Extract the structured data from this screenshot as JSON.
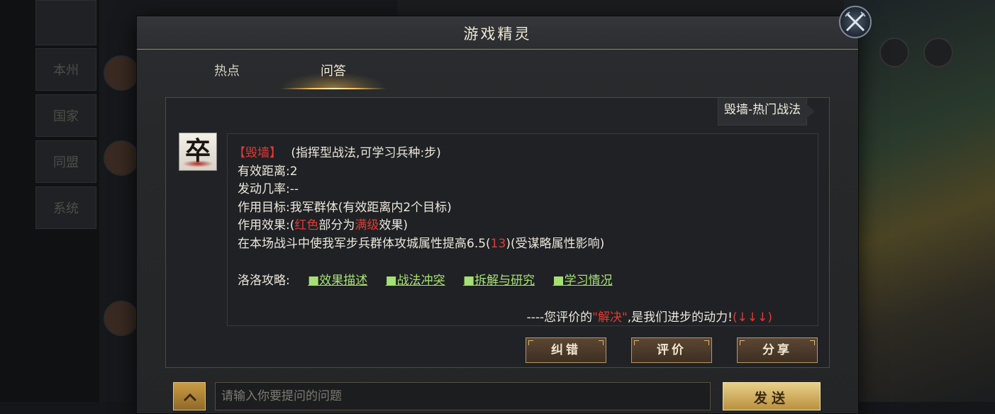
{
  "background": {
    "left_tabs": [
      "",
      "本州",
      "国家",
      "同盟",
      "系统"
    ]
  },
  "dialog": {
    "title": "游戏精灵",
    "tabs": [
      {
        "label": "热点",
        "active": false
      },
      {
        "label": "问答",
        "active": true
      }
    ]
  },
  "topic_tag": "毁墙-热门战法",
  "bot": {
    "avatar_char": "卒"
  },
  "answer": {
    "skill_name": "【毁墙】",
    "skill_type": "(指挥型战法,可学习兵种:步)",
    "range": "有效距离:2",
    "trigger_rate": "发动几率:--",
    "target": "作用目标:我军群体(有效距离内2个目标)",
    "effect_prefix": "作用效果:(",
    "effect_red": "红色",
    "effect_mid": "部分为",
    "effect_max": "满级",
    "effect_suffix": "效果)",
    "desc_prefix": "在本场战斗中使我军步兵群体攻城属性提高6.5(",
    "desc_max_value": "13",
    "desc_suffix": ")(受谋略属性影响)",
    "guide_label": "洛洛攻略:",
    "guide_links": [
      "■效果描述",
      "■战法冲突",
      "■拆解与研究",
      "■学习情况"
    ],
    "feedback_prefix": "----您评价的",
    "feedback_word": "\"解决\"",
    "feedback_mid": ",是我们进步的动力!",
    "feedback_arrows": "(↓↓↓)"
  },
  "actions": {
    "correct": "纠错",
    "rate": "评价",
    "share": "分享"
  },
  "input": {
    "placeholder": "请输入你要提问的问题",
    "send": "发送"
  },
  "colors": {
    "accent_gold": "#f2c36b",
    "highlight_red": "#e23a35",
    "link_green": "#a6e074"
  }
}
